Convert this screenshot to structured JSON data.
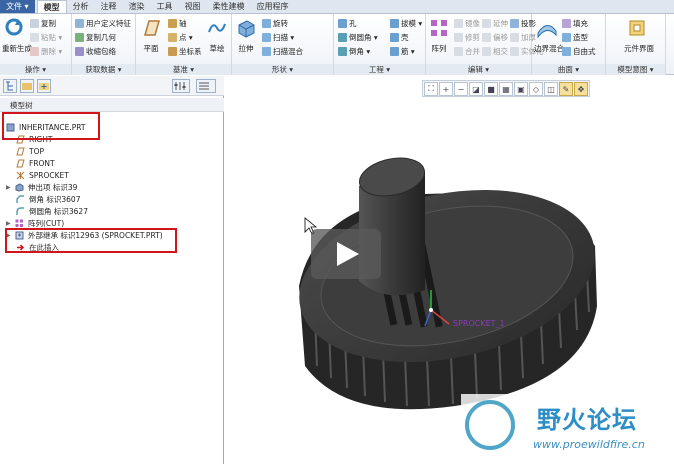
{
  "tabs": [
    {
      "label": "文件 ▾",
      "active": false,
      "file": true
    },
    {
      "label": "模型",
      "active": true
    },
    {
      "label": "分析",
      "active": false
    },
    {
      "label": "注释",
      "active": false
    },
    {
      "label": "渲染",
      "active": false
    },
    {
      "label": "工具",
      "active": false
    },
    {
      "label": "视图",
      "active": false
    },
    {
      "label": "柔性建模",
      "active": false
    },
    {
      "label": "应用程序",
      "active": false
    }
  ],
  "ribbon": {
    "groups": {
      "operations": "操作 ▾",
      "get_data": "获取数据 ▾",
      "datum": "基准 ▾",
      "shapes": "形状 ▾",
      "engineering": "工程 ▾",
      "edit": "编辑 ▾",
      "surface": "曲面 ▾",
      "model_intent": "模型意图 ▾"
    },
    "regen_label": "重新生成",
    "copy": "复制",
    "paste": "粘贴 ▾",
    "delete": "删除 ▾",
    "udf": "用户定义特征",
    "copy_geom": "复制几何",
    "shrinkwrap": "收缩包络",
    "plane": "平面",
    "axis": "轴",
    "point": "点 ▾",
    "csys": "坐标系",
    "sketch": "草绘",
    "extrude": "拉伸",
    "revolve": "旋转",
    "sweep": "扫描 ▾",
    "swept_blend": "扫描混合",
    "hole": "孔",
    "round": "倒圆角 ▾",
    "chamfer": "倒角 ▾",
    "draft": "拔模 ▾",
    "shell": "壳",
    "rib": "筋 ▾",
    "pattern": "阵列",
    "mirror": "镜像",
    "trim": "修剪",
    "merge": "合并",
    "extend": "延伸",
    "offset": "偏移",
    "intersect": "相交",
    "project": "投影",
    "thicken": "加厚",
    "solidify": "实体化",
    "boundary": "边界混合",
    "fill": "填充",
    "style": "造型",
    "freestyle": "自由式",
    "component_interface": "元件界面"
  },
  "tree": {
    "header": "模型树",
    "nodes": [
      {
        "label": "INHERITANCE.PRT",
        "icon": "part-icon",
        "color": "#6a7fa8"
      },
      {
        "label": "RIGHT",
        "icon": "datum-plane-icon",
        "color": "#b07a3a"
      },
      {
        "label": "TOP",
        "icon": "datum-plane-icon",
        "color": "#b07a3a"
      },
      {
        "label": "FRONT",
        "icon": "datum-plane-icon",
        "color": "#b07a3a"
      },
      {
        "label": "SPROCKET",
        "icon": "csys-icon",
        "color": "#b07a3a"
      },
      {
        "label": "伸出项 标识39",
        "icon": "extrude-icon",
        "color": "#6a7fa8",
        "expand": "▶"
      },
      {
        "label": "倒角 标识3607",
        "icon": "chamfer-icon",
        "color": "#5aa0b5"
      },
      {
        "label": "倒圆角 标识3627",
        "icon": "round-icon",
        "color": "#5aa0b5"
      },
      {
        "label": "阵列(CUT)",
        "icon": "pattern-icon",
        "color": "#b566c2",
        "expand": "▶"
      },
      {
        "label": "外部继承 标识12963 (SPROCKET.PRT)",
        "icon": "inheritance-icon",
        "color": "#6a7fa8",
        "expand": "▶"
      },
      {
        "label": "在此插入",
        "icon": "insert-here-icon",
        "color": "#d0151b"
      }
    ]
  },
  "canvas": {
    "datum_label": "SPROCKET_1",
    "watermark_cn": "野火论坛",
    "watermark_url": "www.proewildfire.cn"
  },
  "colors": {
    "accent": "#3a64a4",
    "highlight_box": "#d0151b",
    "model": "#2f2f2f"
  }
}
